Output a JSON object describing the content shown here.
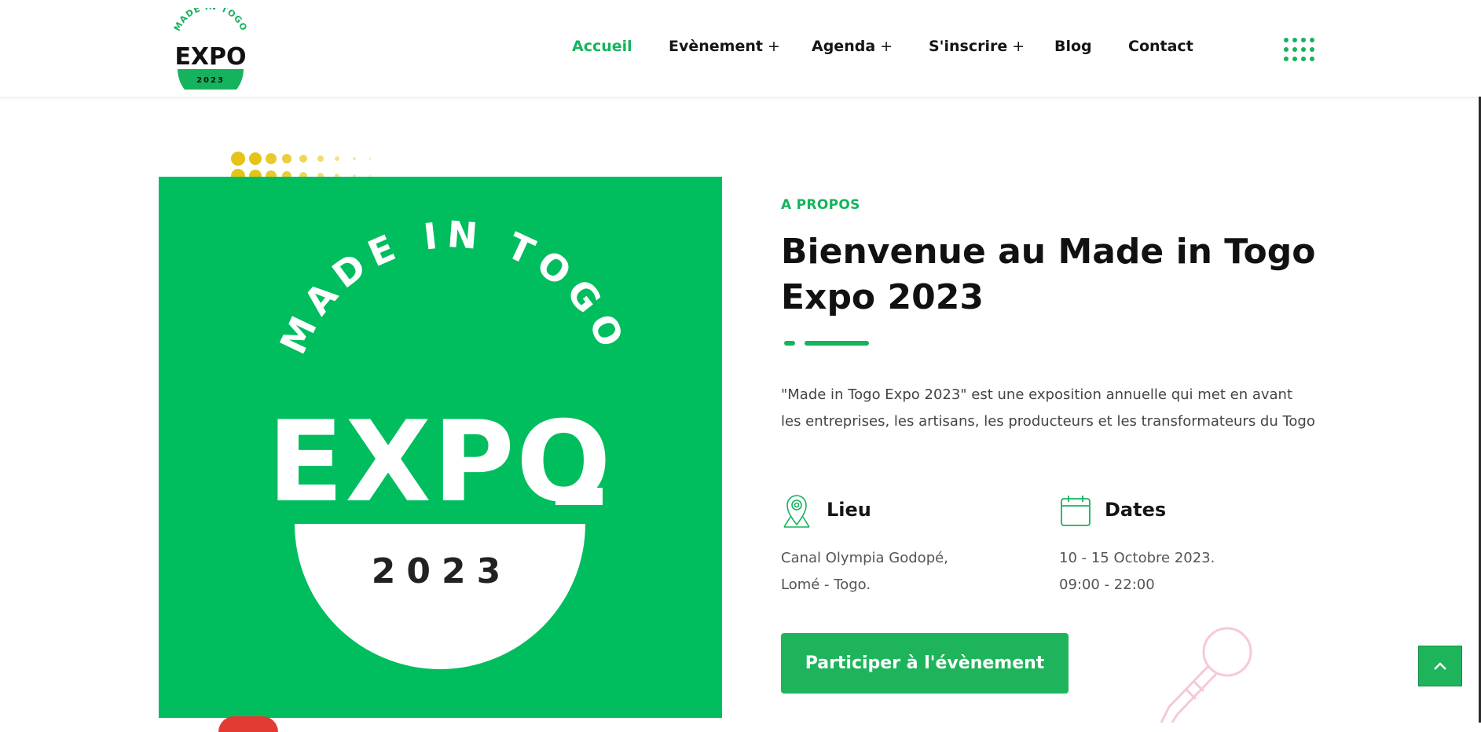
{
  "brand": {
    "logo_top_text": "MADE IN TOGO",
    "logo_main_text": "EXPO",
    "logo_year": "2023"
  },
  "nav": {
    "items": [
      {
        "label": "Accueil",
        "has_submenu": false,
        "active": true
      },
      {
        "label": "Evènement",
        "has_submenu": true,
        "active": false
      },
      {
        "label": "Agenda",
        "has_submenu": true,
        "active": false
      },
      {
        "label": "S'inscrire",
        "has_submenu": true,
        "active": false
      },
      {
        "label": "Blog",
        "has_submenu": false,
        "active": false
      },
      {
        "label": "Contact",
        "has_submenu": false,
        "active": false
      }
    ],
    "submenu_symbol": "+",
    "menu_icon": "dots-grid-icon"
  },
  "about": {
    "eyebrow": "A PROPOS",
    "title": "Bienvenue au Made in Togo Expo 2023",
    "description": "\"Made in Togo Expo 2023\" est une exposition annuelle qui met en avant les entreprises, les artisans, les producteurs et les transformateurs du Togo",
    "location": {
      "icon": "map-pin-icon",
      "title": "Lieu",
      "line1": "Canal Olympia Godopé,",
      "line2": "Lomé - Togo."
    },
    "dates": {
      "icon": "calendar-icon",
      "title": "Dates",
      "line1": "10 - 15 Octobre 2023.",
      "line2": "09:00 - 22:00"
    },
    "cta_label": "Participer à l'évènement"
  },
  "hero_image": {
    "top_text": "MADE IN TOGO",
    "main_text": "EXPO",
    "year": "2023"
  },
  "colors": {
    "brand_green": "#15b35d",
    "image_green": "#00bd5e",
    "dots_yellow": "#e6c417",
    "mic_pink": "#f6c9d4"
  },
  "back_to_top_icon": "chevron-up-icon"
}
